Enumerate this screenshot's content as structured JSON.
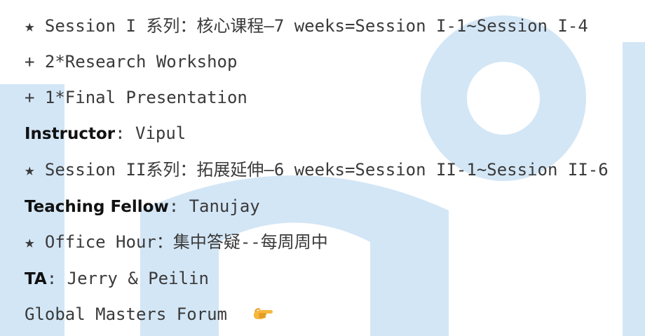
{
  "lines": {
    "session1": "★ Session I 系列：核心课程—7 weeks=Session I-1~Session I-4",
    "workshop": "+ 2*Research Workshop",
    "final": "+ 1*Final Presentation",
    "instructor_label": "Instructor",
    "instructor_value": ": Vipul",
    "session2": "★ Session II系列：拓展延伸—6 weeks=Session II-1~Session II-6",
    "fellow_label": "Teaching Fellow",
    "fellow_value": ": Tanujay",
    "office": "★ Office Hour：集中答疑--每周周中",
    "ta_label": "TA",
    "ta_value": ": Jerry & Peilin",
    "forum": "Global Masters Forum"
  },
  "icons": {
    "forum_icon": "pointing-hand-icon"
  },
  "colors": {
    "watermark": "#d3e6f6",
    "text": "#3a3a3a",
    "label": "#111111",
    "hand": "#f6b73c"
  }
}
